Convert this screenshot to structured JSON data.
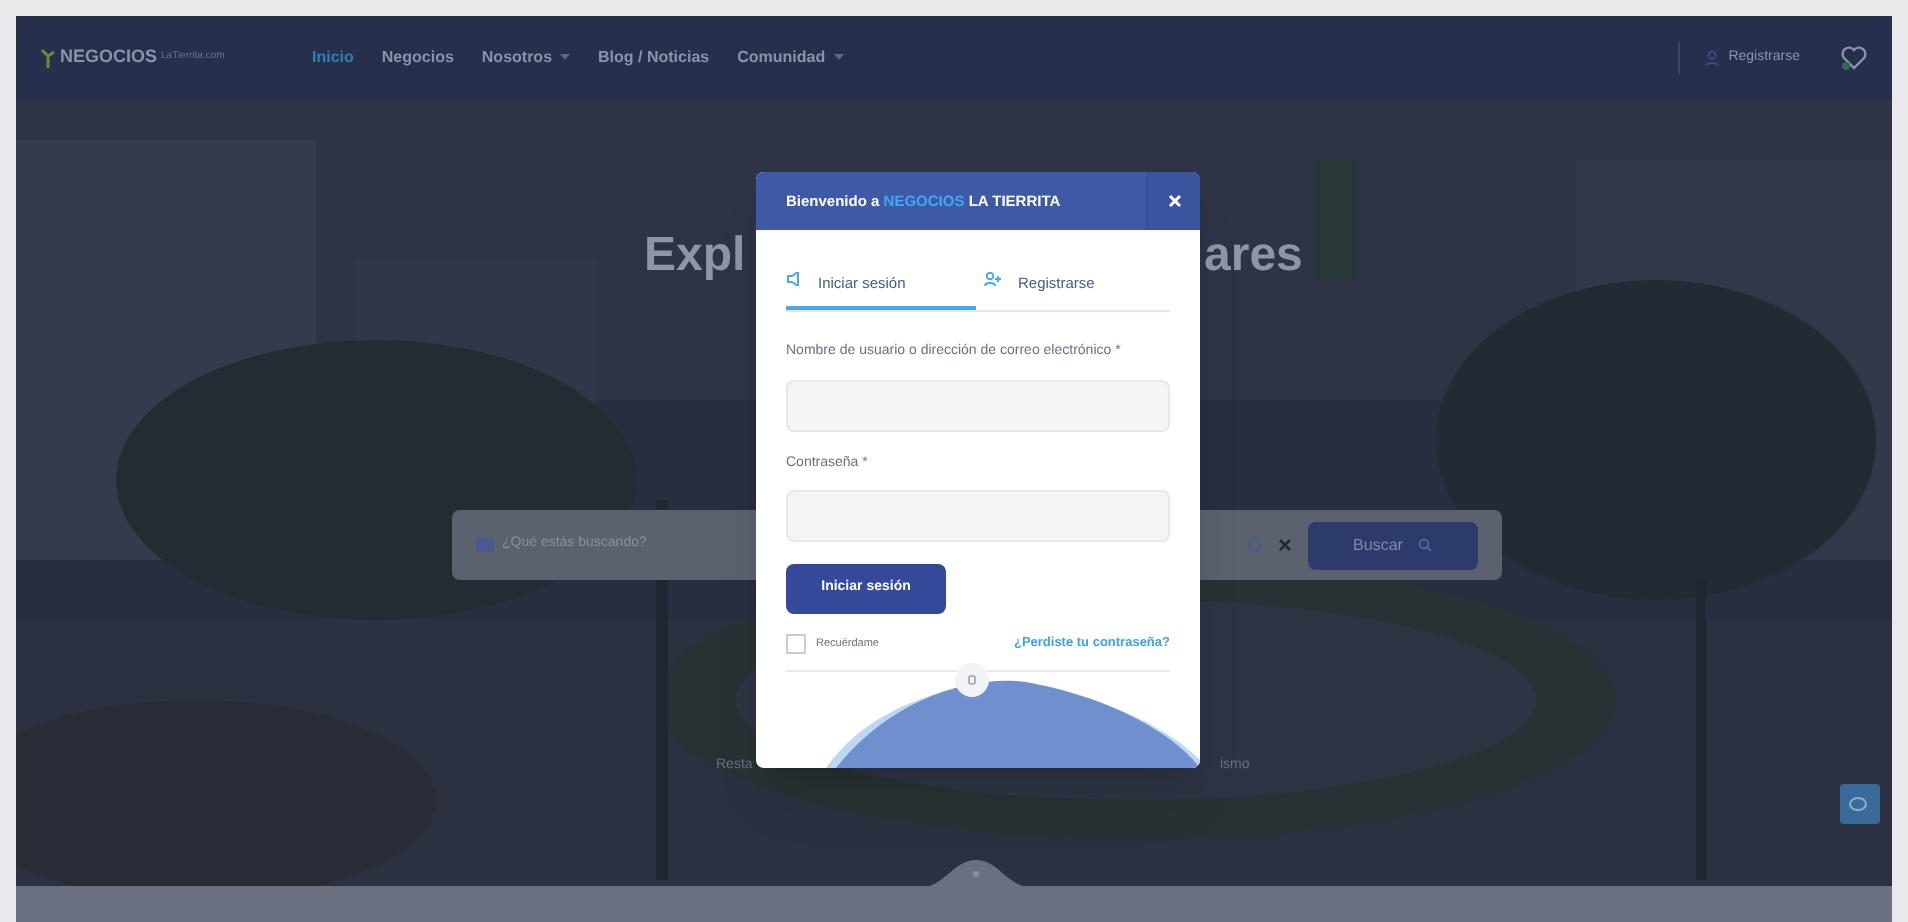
{
  "nav": {
    "logo": "NEGOCIOS",
    "logo_suffix": "LaTierrita.com",
    "links": [
      {
        "label": "Inicio",
        "selected": true,
        "dropdown": false
      },
      {
        "label": "Negocios",
        "selected": false,
        "dropdown": false
      },
      {
        "label": "Nosotros",
        "selected": false,
        "dropdown": true
      },
      {
        "label": "Blog / Noticias",
        "selected": false,
        "dropdown": false
      },
      {
        "label": "Comunidad",
        "selected": false,
        "dropdown": true
      }
    ],
    "register": "Registrarse"
  },
  "hero": {
    "heading_left": "Expl",
    "heading_right": "ares",
    "search": {
      "placeholder": "¿Qué estás buscando?",
      "button": "Buscar"
    },
    "category_left": "Resta",
    "category_right": "ismo"
  },
  "modal": {
    "title_prefix": "Bienvenido a",
    "title_brand": "NEGOCIOS",
    "title_suffix": "LA TIERRITA",
    "tabs": [
      {
        "label": "Iniciar sesión",
        "selected": true,
        "kind": "login"
      },
      {
        "label": "Registrarse",
        "selected": false,
        "kind": "register"
      }
    ],
    "fields": [
      {
        "label": "Nombre de usuario o dirección de correo electrónico *"
      },
      {
        "label": "Contraseña *"
      }
    ],
    "submit": "Iniciar sesión",
    "remember": {
      "label": "Recuérdame",
      "checked": false
    },
    "forgot": "¿Perdiste tu contraseña?"
  }
}
